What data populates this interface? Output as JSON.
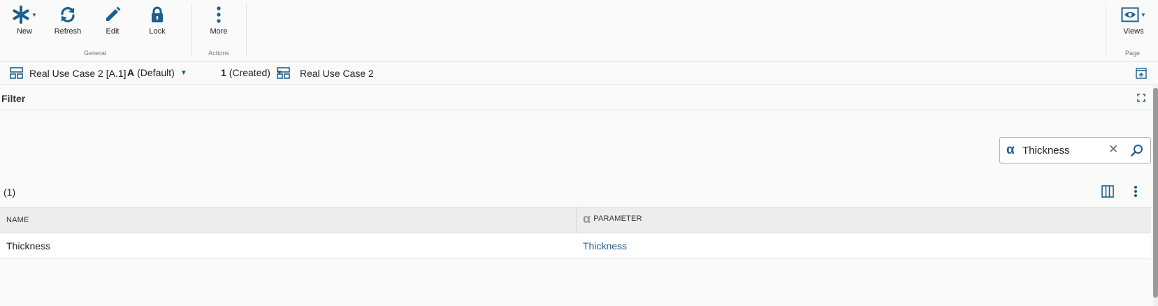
{
  "ribbon": {
    "general": {
      "label": "General",
      "buttons": [
        {
          "label": "New",
          "icon": "asterisk-icon",
          "has_dropdown": true
        },
        {
          "label": "Refresh",
          "icon": "refresh-icon"
        },
        {
          "label": "Edit",
          "icon": "pencil-icon"
        },
        {
          "label": "Lock",
          "icon": "lock-icon"
        }
      ]
    },
    "actions": {
      "label": "Actions",
      "buttons": [
        {
          "label": "More",
          "icon": "kebab-icon"
        }
      ]
    },
    "page": {
      "label": "Page",
      "buttons": [
        {
          "label": "Views",
          "icon": "eye-icon",
          "has_dropdown": true
        }
      ]
    }
  },
  "breadcrumb": {
    "item": "Real Use Case 2 [A.1]",
    "revision_letter": "A",
    "revision_label": "(Default)",
    "state_number": "1",
    "state_label": "(Created)",
    "context": "Real Use Case 2"
  },
  "filter": {
    "title": "Filter",
    "search_value": "Thickness"
  },
  "results": {
    "count": "(1)",
    "columns": [
      {
        "label": "NAME"
      },
      {
        "label": "PARAMETER",
        "icon": "alpha-icon"
      }
    ],
    "rows": [
      {
        "name": "Thickness",
        "parameter": "Thickness"
      }
    ]
  },
  "colors": {
    "accent": "#1d5f8e",
    "header_bg": "#ededed"
  }
}
